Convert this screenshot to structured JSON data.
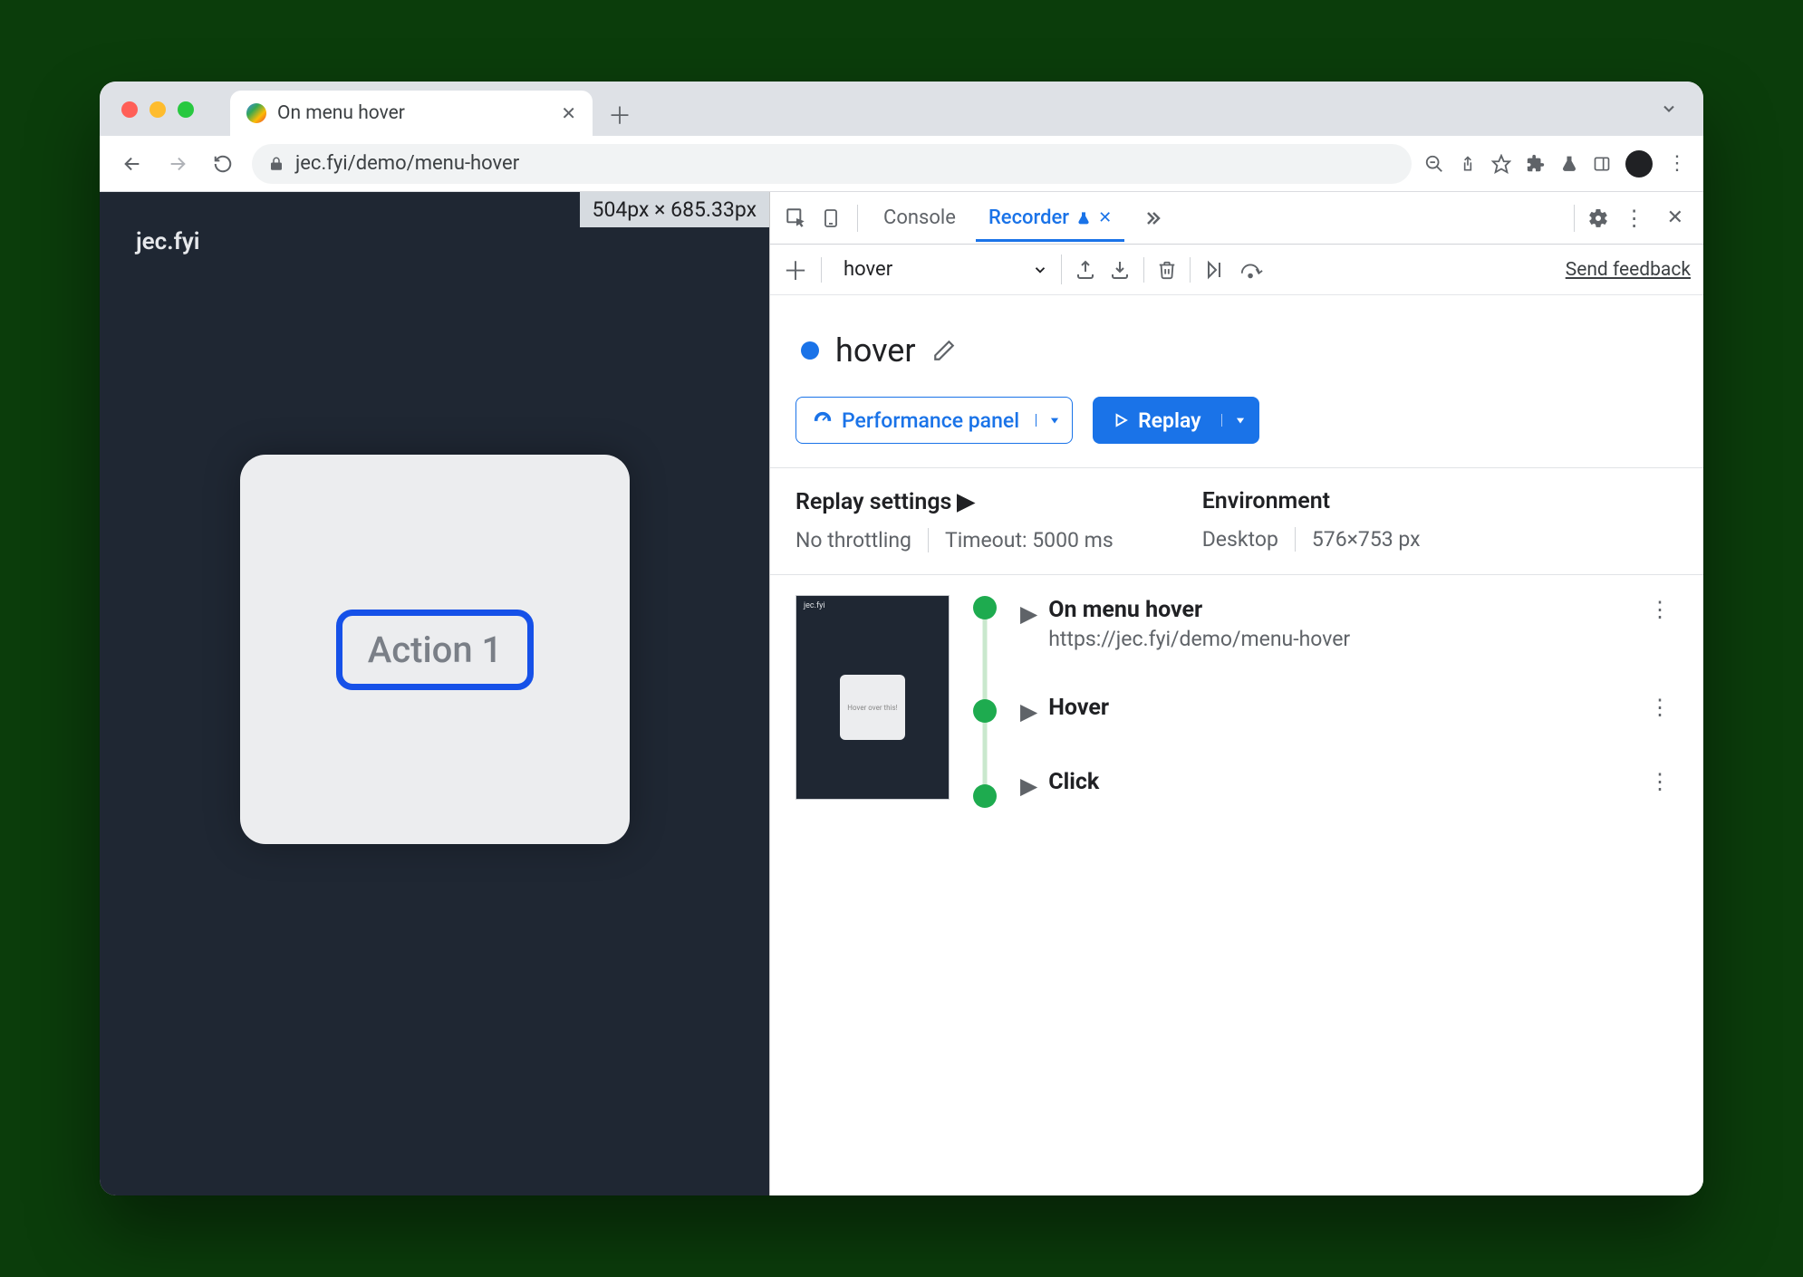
{
  "tab": {
    "title": "On menu hover"
  },
  "omnibox": {
    "url": "jec.fyi/demo/menu-hover"
  },
  "page": {
    "brand": "jec.fyi",
    "dimensions": "504px × 685.33px",
    "action_label": "Action 1"
  },
  "devtools": {
    "tabs": {
      "console": "Console",
      "recorder": "Recorder"
    },
    "toolbar": {
      "recording_name": "hover",
      "feedback": "Send feedback"
    },
    "title": "hover",
    "perf_button": "Performance panel",
    "replay_button": "Replay",
    "settings": {
      "replay_heading": "Replay settings",
      "throttling": "No throttling",
      "timeout": "Timeout: 5000 ms",
      "env_heading": "Environment",
      "device": "Desktop",
      "viewport": "576×753 px"
    },
    "steps": {
      "s1_title": "On menu hover",
      "s1_url": "https://jec.fyi/demo/menu-hover",
      "s2_title": "Hover",
      "s3_title": "Click",
      "thumb_text": "Hover over this!",
      "thumb_brand": "jec.fyi"
    }
  }
}
